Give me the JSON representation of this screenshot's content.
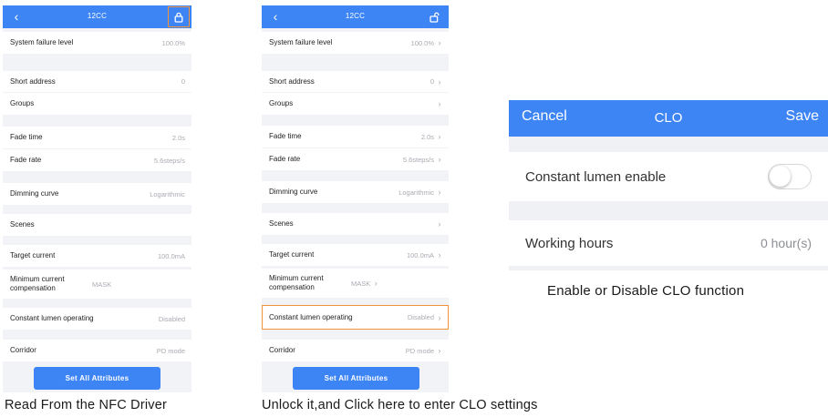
{
  "phone1": {
    "title": "12CC",
    "rows": [
      {
        "label": "System failure level",
        "value": "100.0%"
      },
      {
        "label": "Short address",
        "value": "0"
      },
      {
        "label": "Groups",
        "value": ""
      },
      {
        "label": "Fade time",
        "value": "2.0s"
      },
      {
        "label": "Fade rate",
        "value": "5.6steps/s"
      },
      {
        "label": "Dimming curve",
        "value": "Logarithmic"
      },
      {
        "label": "Scenes",
        "value": ""
      },
      {
        "label": "Target current",
        "value": "100.0mA"
      },
      {
        "label": "Minimum current compensation",
        "value": "MASK"
      },
      {
        "label": "Constant lumen operating",
        "value": "Disabled"
      },
      {
        "label": "Corridor",
        "value": "PD mode"
      }
    ],
    "button": "Set All Attributes"
  },
  "phone2": {
    "title": "12CC",
    "rows": [
      {
        "label": "System failure level",
        "value": "100.0%"
      },
      {
        "label": "Short address",
        "value": "0"
      },
      {
        "label": "Groups",
        "value": ""
      },
      {
        "label": "Fade time",
        "value": "2.0s"
      },
      {
        "label": "Fade rate",
        "value": "5.6steps/s"
      },
      {
        "label": "Dimming curve",
        "value": "Logarithmic"
      },
      {
        "label": "Scenes",
        "value": ""
      },
      {
        "label": "Target current",
        "value": "100.0mA"
      },
      {
        "label": "Minimum current compensation",
        "value": "MASK"
      },
      {
        "label": "Constant lumen operating",
        "value": "Disabled"
      },
      {
        "label": "Corridor",
        "value": "PD mode"
      }
    ],
    "button": "Set All Attributes"
  },
  "clo": {
    "cancel": "Cancel",
    "title": "CLO",
    "save": "Save",
    "enable_label": "Constant lumen enable",
    "enable_state": false,
    "hours_label": "Working hours",
    "hours_value": "0 hour(s)"
  },
  "captions": {
    "left": "Read From the NFC Driver",
    "middle": "Unlock it,and Click here to enter CLO settings",
    "right": "Enable or Disable CLO function"
  },
  "colors": {
    "accent": "#3d84f5",
    "highlight": "#f0933b"
  },
  "icons": {
    "back": "chevron-left-icon",
    "lock_closed": "lock-icon",
    "lock_open": "unlock-icon",
    "row_arrow": "chevron-right-icon"
  }
}
